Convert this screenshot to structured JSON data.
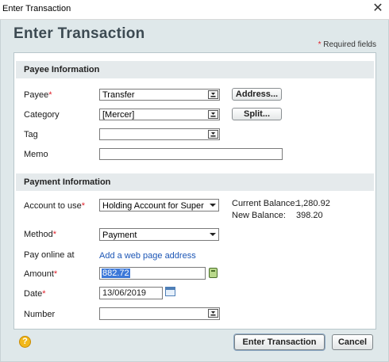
{
  "window": {
    "title": "Enter Transaction",
    "close_glyph": "✕"
  },
  "header": {
    "title": "Enter Transaction",
    "required_star": "*",
    "required_text": "Required fields"
  },
  "payee_section": {
    "title": "Payee Information",
    "payee": {
      "label": "Payee",
      "value": "Transfer",
      "required": true
    },
    "category": {
      "label": "Category",
      "value": "[Mercer]"
    },
    "tag": {
      "label": "Tag",
      "value": ""
    },
    "memo": {
      "label": "Memo",
      "value": ""
    },
    "address_button": "Address...",
    "split_button": "Split..."
  },
  "payment_section": {
    "title": "Payment Information",
    "account": {
      "label": "Account to use",
      "value": "Holding Account for Super",
      "required": true
    },
    "current_balance": {
      "label": "Current Balance:",
      "value": "1,280.92"
    },
    "new_balance": {
      "label": "New Balance:",
      "value": "398.20"
    },
    "method": {
      "label": "Method",
      "value": "Payment",
      "required": true
    },
    "pay_online": {
      "label": "Pay online at",
      "link": "Add a web page address"
    },
    "amount": {
      "label": "Amount",
      "value": "882.72",
      "required": true
    },
    "date": {
      "label": "Date",
      "value": "13/06/2019",
      "required": true
    },
    "number": {
      "label": "Number",
      "value": ""
    }
  },
  "footer": {
    "help_glyph": "?",
    "enter_button": "Enter Transaction",
    "cancel_button": "Cancel"
  },
  "colors": {
    "accent": "#3c78d8",
    "required": "#e0202a",
    "link": "#1b55b5",
    "frame": "#dfe8ea"
  }
}
